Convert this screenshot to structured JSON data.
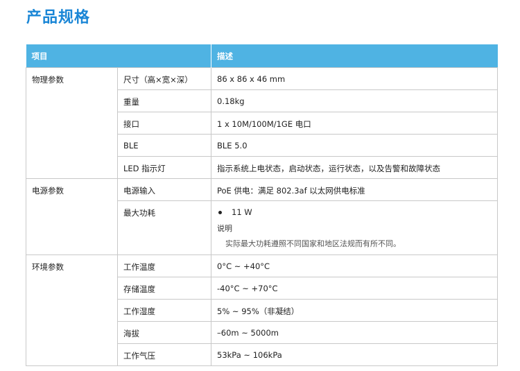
{
  "title": "产品规格",
  "table": {
    "headers": [
      "项目",
      "描述"
    ],
    "groups": [
      {
        "name": "物理参数",
        "rows": [
          {
            "param": "尺寸（高×宽×深）",
            "value": "86 x 86 x 46 mm"
          },
          {
            "param": "重量",
            "value": "0.18kg"
          },
          {
            "param": "接口",
            "value": "1 x 10M/100M/1GE 电口"
          },
          {
            "param": "BLE",
            "value": "BLE 5.0"
          },
          {
            "param": "LED 指示灯",
            "value": "指示系统上电状态，启动状态，运行状态，以及告警和故障状态"
          }
        ]
      },
      {
        "name": "电源参数",
        "rows": [
          {
            "param": "电源输入",
            "value": "PoE 供电：满足 802.3af 以太网供电标准"
          },
          {
            "param": "最大功耗",
            "bullet": "11 W",
            "note_label": "说明",
            "note_text": "实际最大功耗遵照不同国家和地区法规而有所不同。"
          }
        ]
      },
      {
        "name": "环境参数",
        "rows": [
          {
            "param": "工作温度",
            "value": "0°C ~ +40°C"
          },
          {
            "param": "存储温度",
            "value": "-40°C  ~ +70°C"
          },
          {
            "param": "工作湿度",
            "value": "5% ~ 95%（非凝结）"
          },
          {
            "param": "海拔",
            "value": "–60m ~ 5000m"
          },
          {
            "param": "工作气压",
            "value": "53kPa ~ 106kPa"
          }
        ]
      }
    ]
  }
}
